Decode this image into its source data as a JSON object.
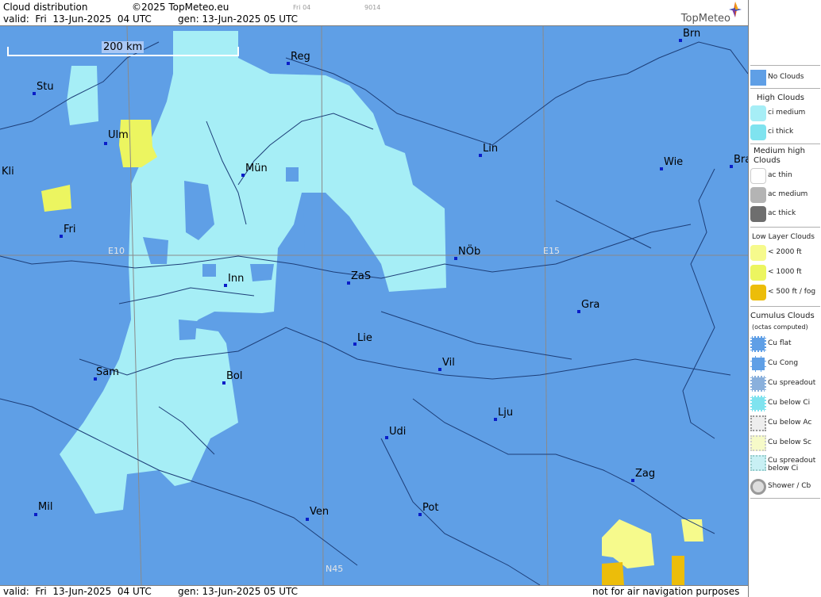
{
  "header": {
    "title": "Cloud distribution",
    "copyright": "©2025 TopMeteo.eu",
    "tab_small_1": "Fri 04",
    "tab_small_2": "9014",
    "valid": "valid:  Fri  13-Jun-2025  04 UTC",
    "gen": "gen: 13-Jun-2025 05 UTC",
    "logo_text": "TopMeteo"
  },
  "map": {
    "scale_label": "200 km",
    "grid_labels": {
      "e10": "E10",
      "e15": "E15",
      "n45": "N45"
    },
    "cities": {
      "brn": "Brn",
      "reg": "Reg",
      "stu": "Stu",
      "ulm": "Ulm",
      "kli": "Kli",
      "lin": "Lin",
      "wie": "Wie",
      "bra": "Bra",
      "mun": "Mün",
      "fri": "Fri",
      "nob": "NÖb",
      "inn": "Inn",
      "zas": "ZaS",
      "gra": "Gra",
      "lie": "Lie",
      "vil": "Vil",
      "sam": "Sam",
      "bol": "Bol",
      "lju": "Lju",
      "udi": "Udi",
      "zag": "Zag",
      "mil": "Mil",
      "ven": "Ven",
      "pot": "Pot"
    }
  },
  "footer": {
    "valid": "valid:  Fri  13-Jun-2025  04 UTC",
    "gen": "gen: 13-Jun-2025 05 UTC",
    "notice": "not for air navigation purposes"
  },
  "legend": {
    "no_clouds": "No Clouds",
    "high_head": "High Clouds",
    "ci_medium": "ci medium",
    "ci_thick": "ci thick",
    "mid_head": "Medium high Clouds",
    "ac_thin": "ac thin",
    "ac_medium": "ac medium",
    "ac_thick": "ac thick",
    "low_head": "Low Layer Clouds",
    "low_2000": "< 2000 ft",
    "low_1000": "< 1000 ft",
    "low_500": "< 500 ft / fog",
    "cu_head": "Cumulus Clouds",
    "cu_sub": "(octas computed)",
    "cu_flat": "Cu flat",
    "cu_cong": "Cu Cong",
    "cu_spread": "Cu spreadout",
    "cu_below_ci": "Cu below Ci",
    "cu_below_ac": "Cu below Ac",
    "cu_below_sc": "Cu below Sc",
    "cu_spread_ci": "Cu spreadout below Ci",
    "shower": "Shower / Cb"
  },
  "colors": {
    "no_clouds": "#5f9fe6",
    "ci_medium": "#a6eef6",
    "ci_thick": "#7fe3ef",
    "low_2000": "#f6fa8c",
    "low_1000": "#ecf560",
    "low_500": "#ecbd0a"
  }
}
